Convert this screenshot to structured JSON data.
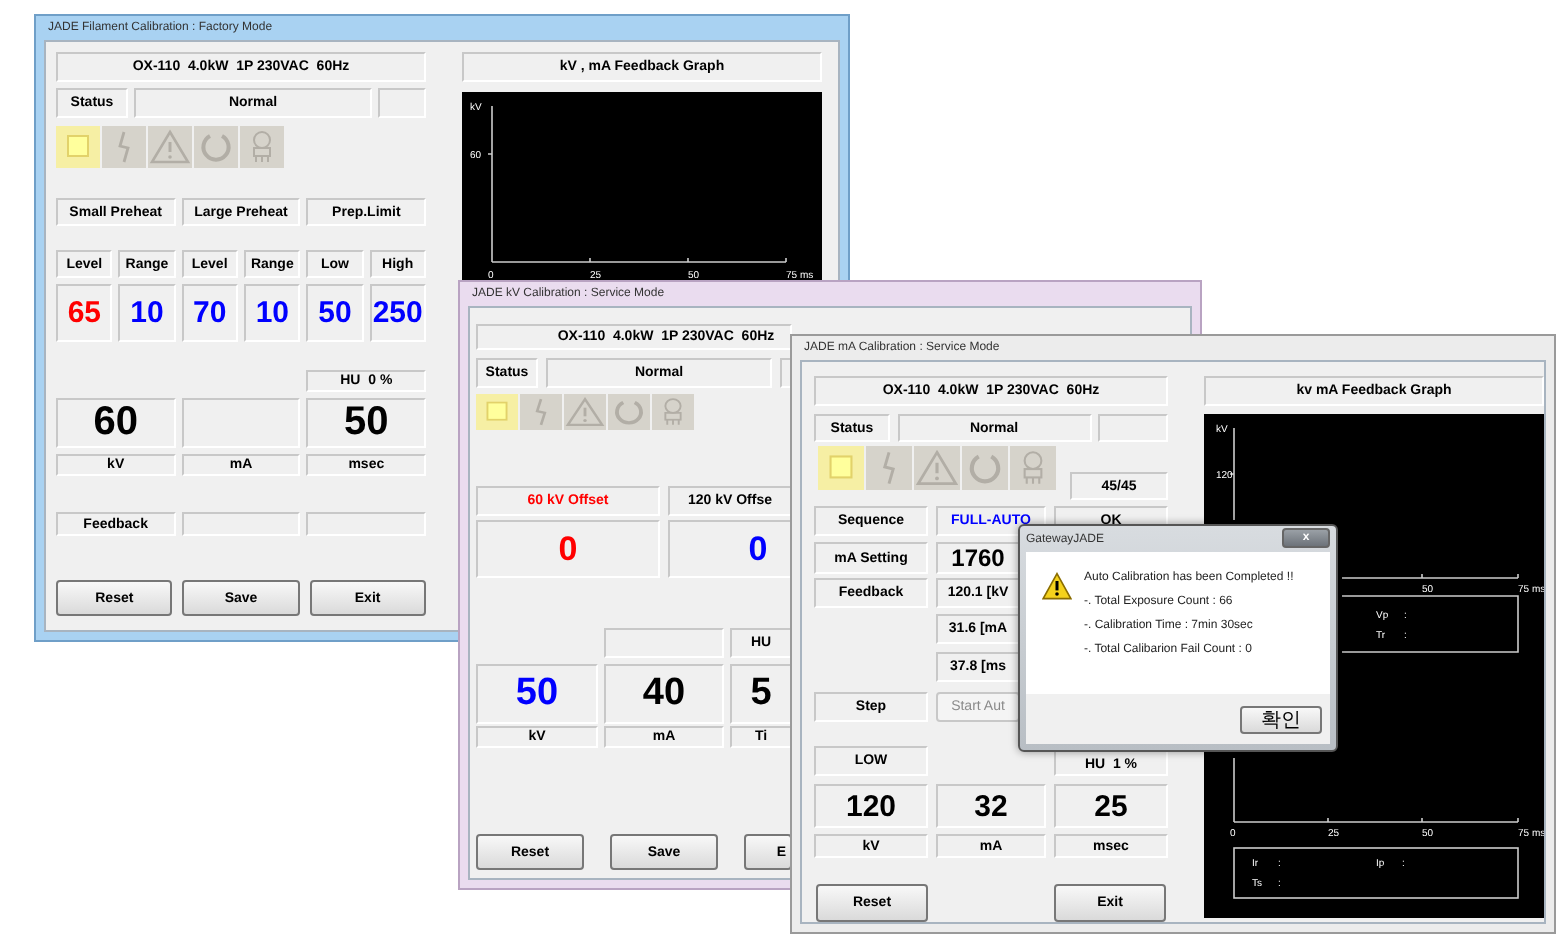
{
  "filament_window": {
    "title": "JADE Filament Calibration : Factory Mode",
    "model": "OX-110  4.0kW  1P 230VAC  60Hz",
    "status_label": "Status",
    "status": "Normal",
    "indicators": [
      {
        "kind": "square",
        "on": true
      },
      {
        "kind": "bolt",
        "on": false
      },
      {
        "kind": "warning",
        "on": false
      },
      {
        "kind": "power",
        "on": false
      },
      {
        "kind": "tube",
        "on": false
      }
    ],
    "preheat_groups": [
      {
        "label": "Small Preheat",
        "fields": [
          {
            "label": "Level",
            "value": "65",
            "color": "#ff0000"
          },
          {
            "label": "Range",
            "value": "10",
            "color": "#0000ff"
          }
        ]
      },
      {
        "label": "Large Preheat",
        "fields": [
          {
            "label": "Level",
            "value": "70",
            "color": "#0000ff"
          },
          {
            "label": "Range",
            "value": "10",
            "color": "#0000ff"
          }
        ]
      },
      {
        "label": "Prep.Limit",
        "fields": [
          {
            "label": "Low",
            "value": "50",
            "color": "#0000ff"
          },
          {
            "label": "High",
            "value": "250",
            "color": "#0000ff"
          }
        ]
      }
    ],
    "hu": "HU  0 %",
    "readouts": [
      {
        "value": "60",
        "unit": "kV"
      },
      {
        "unit": "mA"
      },
      {
        "value": "50",
        "unit": "msec"
      }
    ],
    "feedback_label": "Feedback",
    "buttons": [
      "Reset",
      "Save",
      "Exit"
    ],
    "graph": {
      "title": "kV , mA Feedback Graph",
      "y_labels": [
        "kV",
        "60"
      ],
      "x_labels": [
        "0",
        "25",
        "50",
        "75 ms"
      ]
    }
  },
  "kv_window": {
    "title": "JADE kV Calibration : Service Mode",
    "model": "OX-110  4.0kW  1P 230VAC  60Hz",
    "status_label": "Status",
    "status": "Normal",
    "indicators": [
      {
        "kind": "square",
        "on": true
      },
      {
        "kind": "bolt",
        "on": false
      },
      {
        "kind": "warning",
        "on": false
      },
      {
        "kind": "power",
        "on": false
      },
      {
        "kind": "tube",
        "on": false
      }
    ],
    "offsets": [
      {
        "label": {
          "text": "60 kV Offset",
          "color": "#ff0000"
        },
        "value": {
          "text": "0",
          "color": "#ff0000"
        }
      },
      {
        "label": {
          "text": "120 kV Offse",
          "color": "#000000"
        },
        "value": {
          "text": "0",
          "color": "#0000ff"
        }
      }
    ],
    "hu": "HU",
    "readouts": [
      {
        "value": "50",
        "unit": "kV",
        "color": "#0000ff"
      },
      {
        "value": "40",
        "unit": "mA",
        "color": "#000000"
      },
      {
        "value": "5",
        "unit": "Ti",
        "color": "#000000"
      }
    ],
    "buttons": [
      "Reset",
      "Save",
      "E"
    ]
  },
  "ma_window": {
    "title": "JADE mA Calibration : Service Mode",
    "model": "OX-110  4.0kW  1P 230VAC  60Hz",
    "status_label": "Status",
    "status": "Normal",
    "indicators": [
      {
        "kind": "square",
        "on": true
      },
      {
        "kind": "bolt",
        "on": false
      },
      {
        "kind": "warning",
        "on": false
      },
      {
        "kind": "power",
        "on": false
      },
      {
        "kind": "tube",
        "on": false
      }
    ],
    "counter": "45/45",
    "rows": [
      {
        "kind": "mode",
        "label": "Sequence",
        "value": "FULL-AUTO",
        "result": "OK",
        "disabled": false
      },
      {
        "kind": "setting",
        "label": "mA Setting",
        "value": "1760",
        "disabled": false
      },
      {
        "kind": "reading",
        "label": "Feedback",
        "value": "120.1 [kV",
        "disabled": false
      },
      {
        "kind": "reading",
        "value": "31.6 [mA",
        "disabled": false
      },
      {
        "kind": "reading",
        "value": "37.8 [ms",
        "disabled": false
      },
      {
        "kind": "action",
        "label": "Step",
        "value": "Start Aut",
        "disabled": true
      }
    ],
    "range": "LOW",
    "hu": "HU  1 %",
    "readouts": [
      {
        "value": "120",
        "unit": "kV"
      },
      {
        "value": "32",
        "unit": "mA"
      },
      {
        "value": "25",
        "unit": "msec"
      }
    ],
    "buttons": [
      "Reset",
      "Exit"
    ],
    "graph": {
      "title": "kv mA Feedback Graph",
      "upper": {
        "y_labels": [
          "kV",
          "120"
        ],
        "x_labels": [
          "50",
          "75 ms"
        ],
        "legend": [
          {
            "name": "Vp",
            "sep": ":"
          },
          {
            "name": "Tr",
            "sep": ":"
          }
        ]
      },
      "lower": {
        "x_labels": [
          "0",
          "25",
          "50",
          "75 ms"
        ],
        "legend": [
          {
            "name": "Ir",
            "sep": ":"
          },
          {
            "name": "Ip",
            "sep": ":"
          },
          {
            "name": "Ts",
            "sep": ":"
          }
        ]
      }
    }
  },
  "dialog": {
    "title": "GatewayJADE",
    "close": "x",
    "message": "Auto Calibration has been Completed !!",
    "details": [
      "-. Total Exposure Count : 66",
      "-. Calibration Time : 7min 30sec",
      "-. Total Calibarion Fail Count : 0"
    ],
    "button": "확인"
  }
}
